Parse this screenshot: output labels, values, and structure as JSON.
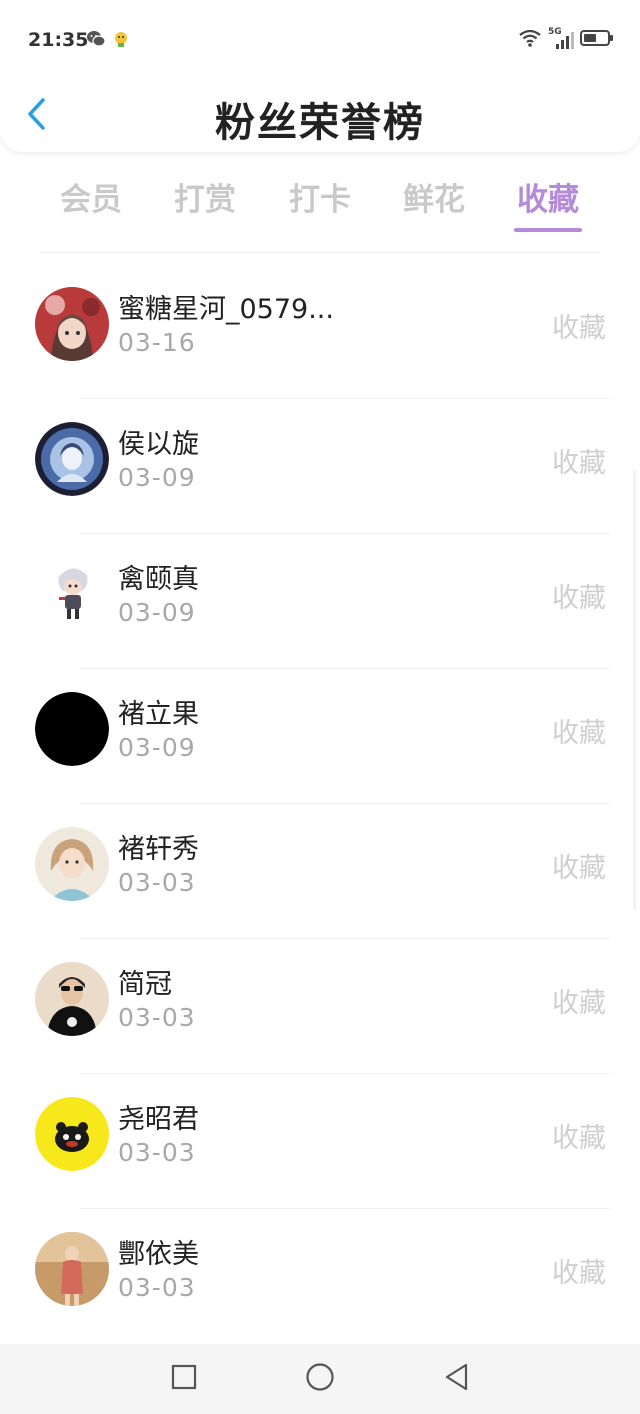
{
  "status_bar": {
    "time": "21:35",
    "app_icons": [
      "wechat-icon",
      "app-notification-icon"
    ],
    "network": "5G"
  },
  "header": {
    "title": "粉丝荣誉榜",
    "back_icon": "chevron-left-icon"
  },
  "tabs": [
    {
      "label": "会员",
      "active": false
    },
    {
      "label": "打赏",
      "active": false
    },
    {
      "label": "打卡",
      "active": false
    },
    {
      "label": "鲜花",
      "active": false
    },
    {
      "label": "收藏",
      "active": true
    }
  ],
  "fans": [
    {
      "name": "蜜糖星河_0579...",
      "date": "03-16",
      "action": "收藏"
    },
    {
      "name": "侯以旋",
      "date": "03-09",
      "action": "收藏"
    },
    {
      "name": "禽颐真",
      "date": "03-09",
      "action": "收藏"
    },
    {
      "name": "褚立果",
      "date": "03-09",
      "action": "收藏"
    },
    {
      "name": "褚轩秀",
      "date": "03-03",
      "action": "收藏"
    },
    {
      "name": "简冠",
      "date": "03-03",
      "action": "收藏"
    },
    {
      "name": "尧昭君",
      "date": "03-03",
      "action": "收藏"
    },
    {
      "name": "酆依美",
      "date": "03-03",
      "action": "收藏"
    }
  ],
  "colors": {
    "accent": "#b58ad8",
    "back_arrow": "#2a9fe0",
    "inactive_tab": "#c9c9c9",
    "muted_text": "#a8a8a8"
  },
  "system_nav": [
    "recent-apps-icon",
    "home-icon",
    "back-icon"
  ]
}
